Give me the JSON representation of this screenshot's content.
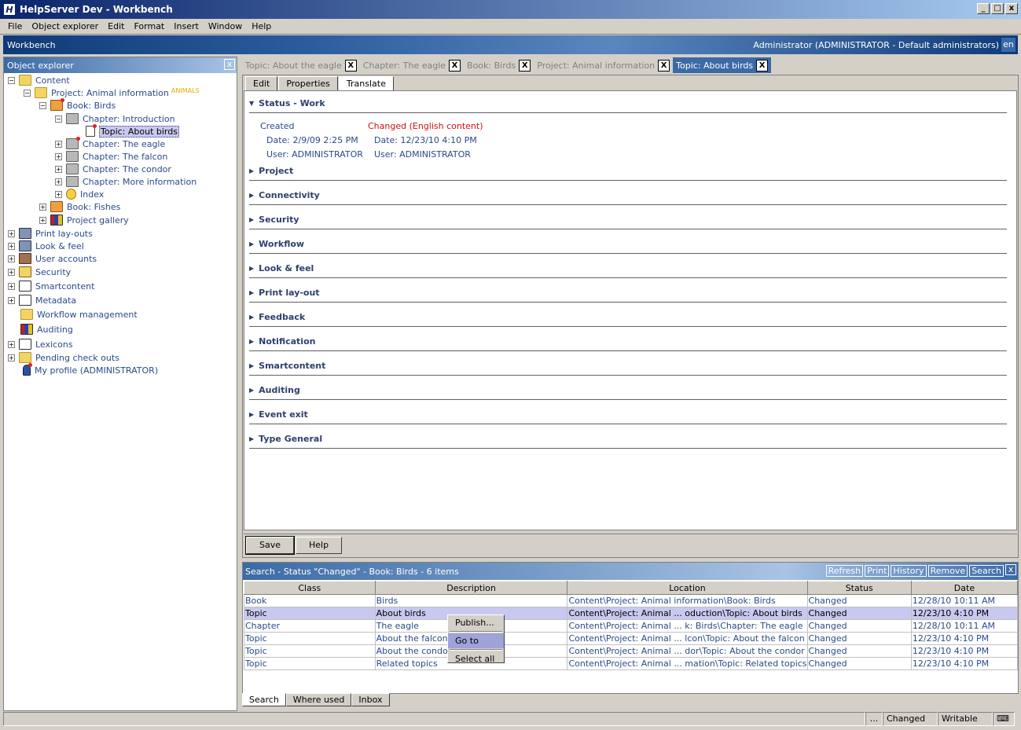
{
  "window": {
    "title": "HelpServer Dev - Workbench",
    "icon_label": "H",
    "min": "_",
    "max": "□",
    "close": "x"
  },
  "menu": [
    "File",
    "Object explorer",
    "Edit",
    "Format",
    "Insert",
    "Window",
    "Help"
  ],
  "banner": {
    "title": "Workbench",
    "user": "Administrator (ADMINISTRATOR - Default administrators)",
    "lang": "en"
  },
  "explorer": {
    "title": "Object explorer",
    "close": "x",
    "nodes": [
      {
        "label": "Content",
        "icon": "folder-open-icon"
      },
      {
        "label": "Project: Animal information",
        "icon": "project-icon",
        "tag": "ANIMALS"
      },
      {
        "label": "Book: Birds",
        "icon": "book-open-icon"
      },
      {
        "label": "Chapter: Introduction",
        "icon": "chapter-icon"
      },
      {
        "label": "Topic: About birds",
        "icon": "topic-icon"
      },
      {
        "label": "Chapter: The eagle",
        "icon": "chapter-icon"
      },
      {
        "label": "Chapter: The falcon",
        "icon": "chapter-icon"
      },
      {
        "label": "Chapter: The condor",
        "icon": "chapter-icon"
      },
      {
        "label": "Chapter: More information",
        "icon": "chapter-icon"
      },
      {
        "label": "Index",
        "icon": "key-icon"
      },
      {
        "label": "Book: Fishes",
        "icon": "book-icon"
      },
      {
        "label": "Project gallery",
        "icon": "gallery-icon"
      },
      {
        "label": "Print lay-outs",
        "icon": "printer-icon"
      },
      {
        "label": "Look & feel",
        "icon": "look-feel-icon"
      },
      {
        "label": "User accounts",
        "icon": "users-icon"
      },
      {
        "label": "Security",
        "icon": "lock-icon"
      },
      {
        "label": "Smartcontent",
        "icon": "smartcontent-icon"
      },
      {
        "label": "Metadata",
        "icon": "metadata-icon"
      },
      {
        "label": "Workflow management",
        "icon": "workflow-folder-icon"
      },
      {
        "label": "Auditing",
        "icon": "auditing-chart-icon"
      },
      {
        "label": "Lexicons",
        "icon": "lexicon-abc-icon"
      },
      {
        "label": "Pending check outs",
        "icon": "checkout-folder-icon"
      },
      {
        "label": "My profile (ADMINISTRATOR)",
        "icon": "profile-person-icon"
      }
    ]
  },
  "doctabs": [
    {
      "label": "Topic: About the eagle"
    },
    {
      "label": "Chapter: The eagle"
    },
    {
      "label": "Book: Birds"
    },
    {
      "label": "Project: Animal information"
    },
    {
      "label": "Topic: About birds"
    }
  ],
  "doctab_close": "X",
  "subtabs": [
    "Edit",
    "Properties",
    "Translate"
  ],
  "status": {
    "heading": "Status - Work",
    "created_label": "Created",
    "created_date": "Date:  2/9/09 2:25 PM",
    "created_user": "User:  ADMINISTRATOR",
    "changed_label": "Changed   (English content)",
    "changed_date": "Date:  12/23/10 4:10 PM",
    "changed_user": "User:  ADMINISTRATOR"
  },
  "sections": [
    "Project",
    "Connectivity",
    "Security",
    "Workflow",
    "Look & feel",
    "Print lay-out",
    "Feedback",
    "Notification",
    "Smartcontent",
    "Auditing",
    "Event exit",
    "Type General"
  ],
  "buttons": {
    "save": "Save",
    "help": "Help"
  },
  "search": {
    "title": "Search - Status \"Changed\" - Book: Birds - 6 items",
    "actions": [
      "Refresh",
      "Print",
      "History",
      "Remove",
      "Search"
    ],
    "close": "x",
    "columns": [
      "Class",
      "Description",
      "Location",
      "Status",
      "Date"
    ],
    "rows": [
      [
        "Book",
        "Birds",
        "Content\\Project: Animal information\\Book: Birds",
        "Changed",
        "12/28/10 10:11 AM"
      ],
      [
        "Topic",
        "About birds",
        "Content\\Project: Animal  ... oduction\\Topic: About birds",
        "Changed",
        "12/23/10 4:10 PM"
      ],
      [
        "Chapter",
        "The eagle",
        "Content\\Project: Animal  ... k: Birds\\Chapter: The eagle",
        "Changed",
        "12/28/10 10:11 AM"
      ],
      [
        "Topic",
        "About the falcon",
        "Content\\Project: Animal  ... lcon\\Topic: About the falcon",
        "Changed",
        "12/23/10 4:10 PM"
      ],
      [
        "Topic",
        "About the condor",
        "Content\\Project: Animal  ... dor\\Topic: About the condor",
        "Changed",
        "12/23/10 4:10 PM"
      ],
      [
        "Topic",
        "Related topics",
        "Content\\Project: Animal  ... mation\\Topic: Related topics",
        "Changed",
        "12/23/10 4:10 PM"
      ]
    ],
    "selected_row": 1
  },
  "context_menu": [
    "Publish...",
    "Go to",
    "Select all"
  ],
  "bottom_tabs": [
    "Search",
    "Where used",
    "Inbox"
  ],
  "statusbar": {
    "dots": "...",
    "changed": "Changed",
    "writable": "Writable"
  },
  "colors": {
    "selected_row": "#c8c8f0",
    "changed_red": "#d01010",
    "banner": "#0f3a78"
  }
}
